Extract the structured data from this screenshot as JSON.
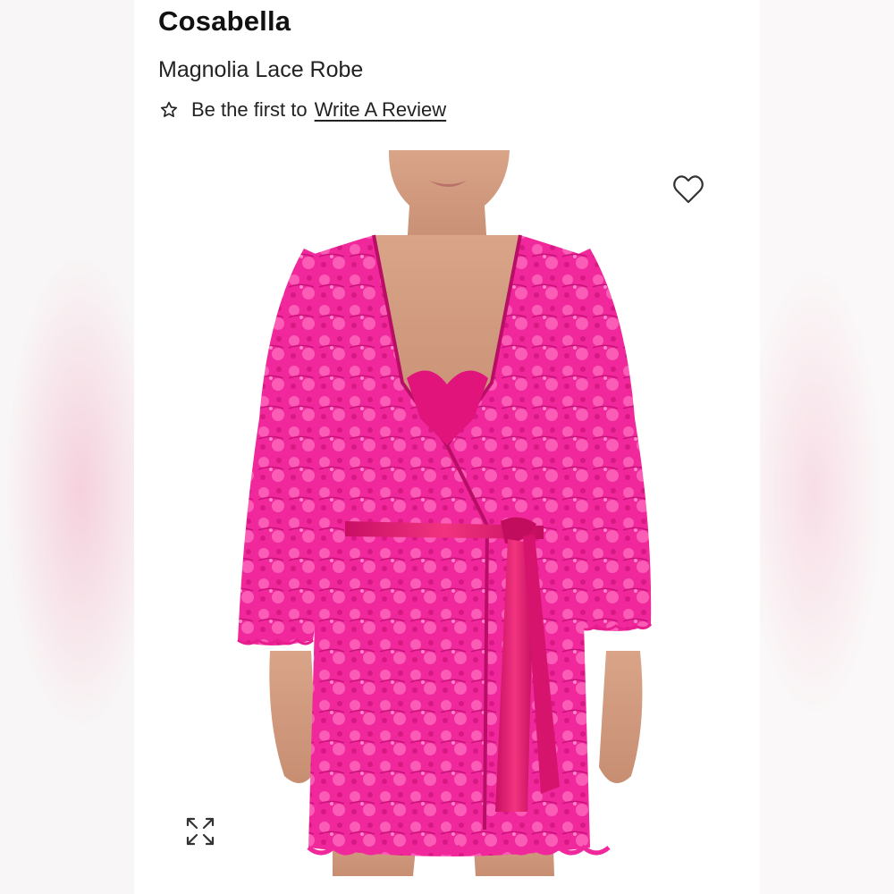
{
  "product": {
    "brand": "Cosabella",
    "name": "Magnolia Lace Robe",
    "review_prefix": "Be the first to",
    "review_link": "Write A Review"
  },
  "icons": {
    "rating": "star-outline-icon",
    "favorite": "heart-outline-icon",
    "zoom": "expand-arrows-icon"
  },
  "colors": {
    "robe": "#f2279a",
    "sash": "#e0136e",
    "text": "#111111"
  }
}
